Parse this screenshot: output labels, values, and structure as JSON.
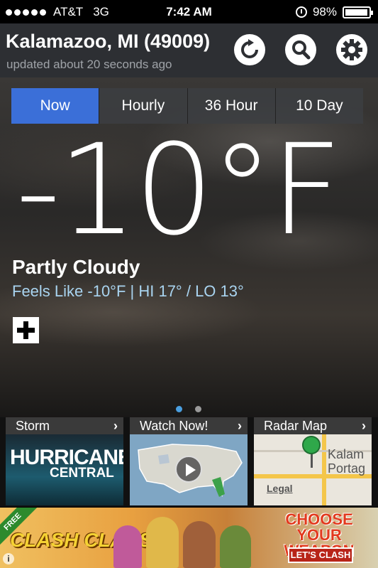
{
  "status_bar": {
    "carrier": "AT&T",
    "network": "3G",
    "time": "7:42 AM",
    "battery_pct_text": "98%",
    "battery_level": 0.98
  },
  "header": {
    "location": "Kalamazoo, MI (49009)",
    "updated": "updated about 20 seconds ago",
    "icons": [
      "refresh-icon",
      "search-icon",
      "gear-icon"
    ]
  },
  "tabs": [
    {
      "label": "Now",
      "active": true
    },
    {
      "label": "Hourly",
      "active": false
    },
    {
      "label": "36 Hour",
      "active": false
    },
    {
      "label": "10 Day",
      "active": false
    }
  ],
  "current": {
    "temperature": "-10°F",
    "condition": "Partly Cloudy",
    "feels_like": "Feels Like -10°F | HI 17° / LO 13°"
  },
  "pager": {
    "pages": 2,
    "current": 1
  },
  "tiles": [
    {
      "title": "Storm",
      "image_text_1": "HURRICANE",
      "image_text_2": "CENTRAL"
    },
    {
      "title": "Watch Now!"
    },
    {
      "title": "Radar Map",
      "city_line_1": "Kalam",
      "city_line_2": "Portag",
      "legal": "Legal"
    }
  ],
  "ad": {
    "badge": "FREE",
    "logo": "CLASH CLANS",
    "headline": "CHOOSE YOUR WEAPON",
    "cta": "LET'S CLASH",
    "info": "i"
  },
  "colors": {
    "accent": "#3b6fd8",
    "feels_like_text": "#a9d4f0",
    "header_bg": "#2d2f33"
  }
}
